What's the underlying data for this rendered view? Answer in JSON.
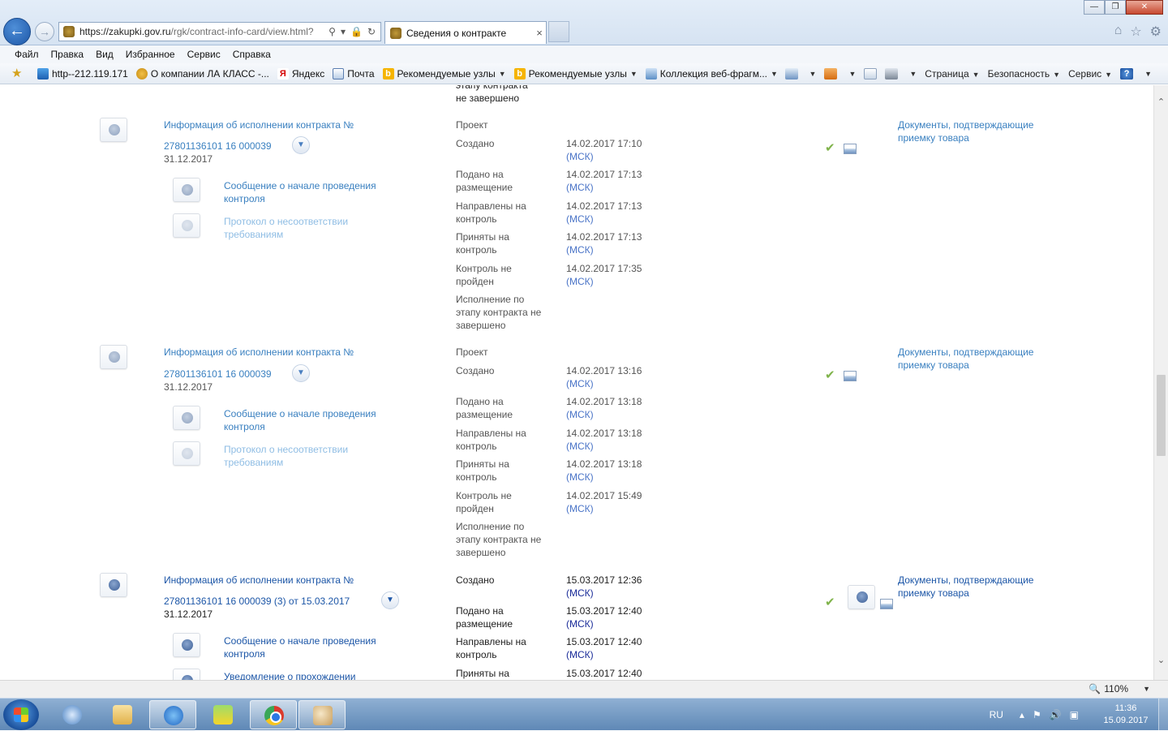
{
  "browser": {
    "url_host": "https://zakupki.gov.ru",
    "url_path": "/rgk/contract-info-card/view.html?",
    "tab_title": "Сведения о контракте",
    "tab_close": "×",
    "window_buttons": [
      "—",
      "❐",
      "✕"
    ],
    "menu": [
      "Файл",
      "Правка",
      "Вид",
      "Избранное",
      "Сервис",
      "Справка"
    ],
    "favorites": [
      {
        "label": "http--212.119.171",
        "icon": "ie-page-icon"
      },
      {
        "label": "О компании ЛА КЛАСС -...",
        "icon": "person-icon"
      },
      {
        "label": "Яндекс",
        "icon": "yandex-icon"
      },
      {
        "label": "Почта",
        "icon": "mail-icon"
      },
      {
        "label": "Рекомендуемые узлы",
        "icon": "bing-icon"
      },
      {
        "label": "Рекомендуемые узлы",
        "icon": "bing-icon"
      },
      {
        "label": "Коллекция веб-фрагм...",
        "icon": "web-slice-icon"
      }
    ],
    "commands": [
      "Страница",
      "Безопасность",
      "Сервис"
    ],
    "zoom": "110%"
  },
  "content": {
    "top_partial": {
      "line1": "этапу контракта",
      "line2": "не завершено"
    },
    "records": [
      {
        "title": "Информация об исполнении контракта №",
        "number": "27801136101 16 000039",
        "date": "31.12.2017",
        "subdocs": [
          {
            "label": "Сообщение о начале проведения контроля"
          },
          {
            "label": "Протокол о несоответствии требованиям"
          }
        ],
        "statuses": [
          {
            "label": "Проект",
            "date": "",
            "tz": ""
          },
          {
            "label": "Создано",
            "date": "14.02.2017 17:10",
            "tz": "(МСК)"
          },
          {
            "label": "Подано на размещение",
            "date": "14.02.2017 17:13",
            "tz": "(МСК)"
          },
          {
            "label": "Направлены на контроль",
            "date": "14.02.2017 17:13",
            "tz": "(МСК)"
          },
          {
            "label": "Приняты на контроль",
            "date": "14.02.2017 17:13",
            "tz": "(МСК)"
          },
          {
            "label": "Контроль не пройден",
            "date": "14.02.2017 17:35",
            "tz": "(МСК)"
          },
          {
            "label": "Исполнение по этапу контракта не завершено",
            "date": "",
            "tz": ""
          }
        ],
        "docs_link": "Документы, подтверждающие приемку товара"
      },
      {
        "title": "Информация об исполнении контракта №",
        "number": "27801136101 16 000039",
        "date": "31.12.2017",
        "subdocs": [
          {
            "label": "Сообщение о начале проведения контроля"
          },
          {
            "label": "Протокол о несоответствии требованиям"
          }
        ],
        "statuses": [
          {
            "label": "Проект",
            "date": "",
            "tz": ""
          },
          {
            "label": "Создано",
            "date": "14.02.2017 13:16",
            "tz": "(МСК)"
          },
          {
            "label": "Подано на размещение",
            "date": "14.02.2017 13:18",
            "tz": "(МСК)"
          },
          {
            "label": "Направлены на контроль",
            "date": "14.02.2017 13:18",
            "tz": "(МСК)"
          },
          {
            "label": "Приняты на контроль",
            "date": "14.02.2017 13:18",
            "tz": "(МСК)"
          },
          {
            "label": "Контроль не пройден",
            "date": "14.02.2017 15:49",
            "tz": "(МСК)"
          },
          {
            "label": "Исполнение по этапу контракта не завершено",
            "date": "",
            "tz": ""
          }
        ],
        "docs_link": "Документы, подтверждающие приемку товара"
      },
      {
        "title": "Информация об исполнении контракта №",
        "number": "27801136101 16 000039 (3) от 15.03.2017",
        "date": "31.12.2017",
        "subdocs": [
          {
            "label": "Сообщение о начале проведения контроля"
          },
          {
            "label": "Уведомление о прохождении"
          }
        ],
        "statuses": [
          {
            "label": "Создано",
            "date": "15.03.2017 12:36",
            "tz": "(МСК)"
          },
          {
            "label": "Подано на размещение",
            "date": "15.03.2017 12:40",
            "tz": "(МСК)"
          },
          {
            "label": "Направлены на контроль",
            "date": "15.03.2017 12:40",
            "tz": "(МСК)"
          },
          {
            "label": "Приняты на",
            "date": "15.03.2017 12:40",
            "tz": ""
          }
        ],
        "docs_link": "Документы, подтверждающие приемку товара"
      }
    ]
  },
  "taskbar": {
    "lang": "RU",
    "time": "11:36",
    "date": "15.09.2017"
  }
}
